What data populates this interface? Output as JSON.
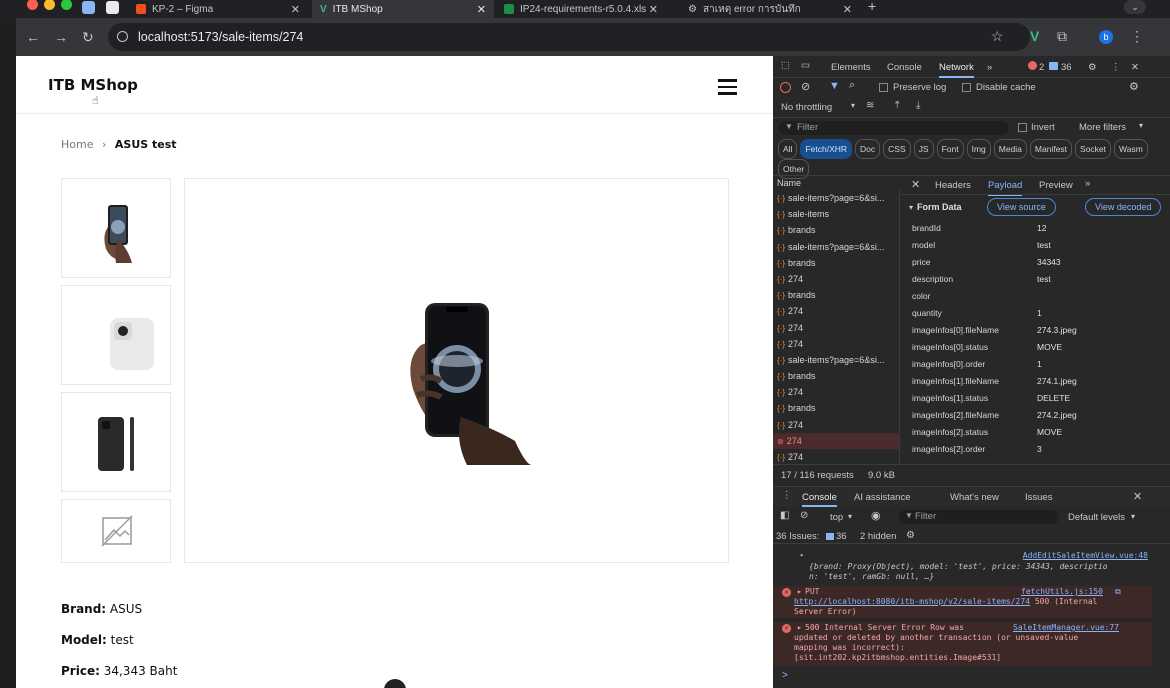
{
  "browser": {
    "tabs": [
      {
        "label": "KP-2 – Figma",
        "active": false
      },
      {
        "label": "ITB MShop",
        "active": true
      },
      {
        "label": "IP24-requirements-r5.0.4.xls",
        "active": false
      },
      {
        "label": "สาเหตุ error การบันทึก",
        "active": false
      }
    ],
    "url": "localhost:5173/sale-items/274",
    "profile_initial": "b"
  },
  "site": {
    "brand": "ITB MShop",
    "breadcrumb": {
      "home": "Home",
      "current": "ASUS test"
    },
    "details": {
      "brand_label": "Brand:",
      "brand_value": "ASUS",
      "model_label": "Model:",
      "model_value": "test",
      "price_label": "Price:",
      "price_value": "34,343 Baht"
    }
  },
  "devtools": {
    "tabs": [
      "Elements",
      "Console",
      "Network"
    ],
    "active_tab": "Network",
    "error_count": "2",
    "issue_count": "36",
    "preserve_log": "Preserve log",
    "disable_cache": "Disable cache",
    "throttling": "No throttling",
    "filter_placeholder": "Filter",
    "invert": "Invert",
    "more_filters": "More filters",
    "type_filters": [
      "All",
      "Fetch/XHR",
      "Doc",
      "CSS",
      "JS",
      "Font",
      "Img",
      "Media",
      "Manifest",
      "Socket",
      "Wasm",
      "Other"
    ],
    "active_filter": "Fetch/XHR",
    "name_header": "Name",
    "requests": [
      {
        "name": "sale-items?page=6&si...",
        "error": false
      },
      {
        "name": "sale-items",
        "error": false
      },
      {
        "name": "brands",
        "error": false
      },
      {
        "name": "sale-items?page=6&si...",
        "error": false
      },
      {
        "name": "brands",
        "error": false
      },
      {
        "name": "274",
        "error": false
      },
      {
        "name": "brands",
        "error": false
      },
      {
        "name": "274",
        "error": false
      },
      {
        "name": "274",
        "error": false
      },
      {
        "name": "274",
        "error": false
      },
      {
        "name": "sale-items?page=6&si...",
        "error": false
      },
      {
        "name": "brands",
        "error": false
      },
      {
        "name": "274",
        "error": false
      },
      {
        "name": "brands",
        "error": false
      },
      {
        "name": "274",
        "error": false
      },
      {
        "name": "274",
        "error": true
      },
      {
        "name": "274",
        "error": false
      }
    ],
    "detail_tabs": [
      "Headers",
      "Payload",
      "Preview"
    ],
    "active_detail_tab": "Payload",
    "form_data_title": "Form Data",
    "view_source": "View source",
    "view_decoded": "View decoded",
    "form_data": [
      {
        "key": "brandId",
        "value": "12"
      },
      {
        "key": "model",
        "value": "test"
      },
      {
        "key": "price",
        "value": "34343"
      },
      {
        "key": "description",
        "value": "test"
      },
      {
        "key": "color",
        "value": ""
      },
      {
        "key": "quantity",
        "value": "1"
      },
      {
        "key": "imageInfos[0].fileName",
        "value": "274.3.jpeg"
      },
      {
        "key": "imageInfos[0].status",
        "value": "MOVE"
      },
      {
        "key": "imageInfos[0].order",
        "value": "1"
      },
      {
        "key": "imageInfos[1].fileName",
        "value": "274.1.jpeg"
      },
      {
        "key": "imageInfos[1].status",
        "value": "DELETE"
      },
      {
        "key": "imageInfos[2].fileName",
        "value": "274.2.jpeg"
      },
      {
        "key": "imageInfos[2].status",
        "value": "MOVE"
      },
      {
        "key": "imageInfos[2].order",
        "value": "3"
      }
    ],
    "status_bar": {
      "requests": "17 / 116 requests",
      "size": "9.0 kB"
    },
    "drawer_tabs": [
      "Console",
      "AI assistance",
      "What's new",
      "Issues"
    ],
    "active_drawer_tab": "Console",
    "context": "top",
    "console_filter": "Filter",
    "levels": "Default levels",
    "issues_label": "36 Issues:",
    "issues_count": "36",
    "hidden": "2 hidden",
    "console": {
      "log_source": "AddEditSaleItemView.vue:48",
      "log_obj_1": "{brand: Proxy(Object), model: 'test', price: 34343, descriptio",
      "log_obj_2": "n: 'test', ramGb: null, …}",
      "put_label": "PUT",
      "put_source": "fetchUtils.js:150",
      "put_url": "http://localhost:8080/itb-mshop/v2/sale-items/274",
      "put_status": " 500 (Internal",
      "put_status_2": "Server Error)",
      "err_source": "SaleItemManager.vue:77",
      "err_1": "500 Internal Server Error Row was",
      "err_2": "updated or deleted by another transaction (or unsaved-value",
      "err_3": "mapping was incorrect):",
      "err_4": "[sit.int202.kp2itbmshop.entities.Image#531]",
      "prompt": ">"
    }
  }
}
